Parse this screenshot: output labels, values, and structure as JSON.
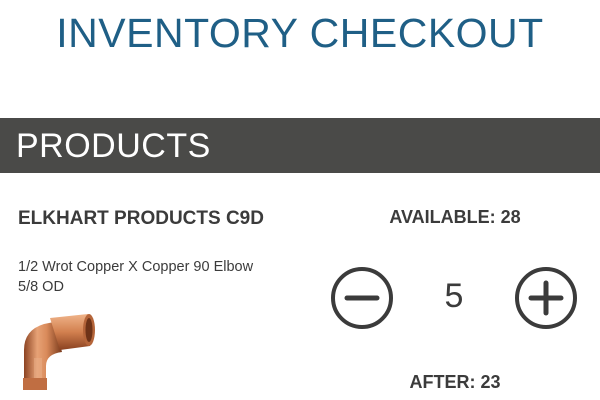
{
  "header": {
    "title": "INVENTORY CHECKOUT"
  },
  "section": {
    "title": "PRODUCTS"
  },
  "product": {
    "name": "ELKHART PRODUCTS C9D",
    "description": "1/2 Wrot Copper X Copper 90 Elbow 5/8 OD",
    "image_icon": "copper-elbow-fitting"
  },
  "stock": {
    "available_label": "AVAILABLE: 28",
    "quantity": "5",
    "after_label": "AFTER: 23"
  },
  "colors": {
    "title": "#1f5f86",
    "bar": "#4a4a48",
    "text": "#3b3b3b",
    "copper": "#c8774a"
  }
}
